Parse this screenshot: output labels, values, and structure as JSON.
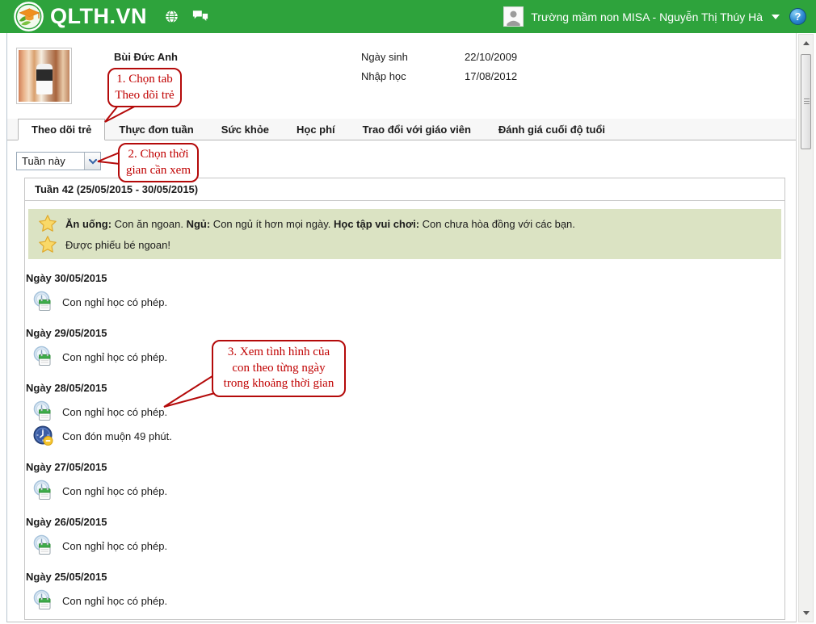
{
  "header": {
    "brand": "QLTH.VN",
    "account": "Trường mầm non MISA - Nguyễn Thị Thúy Hà",
    "help_glyph": "?"
  },
  "student": {
    "name": "Bùi Đức Anh",
    "birth_label": "Ngày sinh",
    "birth_value": "22/10/2009",
    "enroll_label": "Nhập học",
    "enroll_value": "17/08/2012"
  },
  "tabs": [
    {
      "label": "Theo dõi trẻ",
      "active": true
    },
    {
      "label": "Thực đơn tuần",
      "active": false
    },
    {
      "label": "Sức khỏe",
      "active": false
    },
    {
      "label": "Học phí",
      "active": false
    },
    {
      "label": "Trao đổi với giáo viên",
      "active": false
    },
    {
      "label": "Đánh giá cuối độ tuổi",
      "active": false
    }
  ],
  "filter": {
    "selected": "Tuần này"
  },
  "week": {
    "title": "Tuần 42 (25/05/2015 - 30/05/2015)"
  },
  "summary": {
    "line1": [
      {
        "label": "Ăn uống:",
        "text": "Con ăn ngoan."
      },
      {
        "label": "Ngủ:",
        "text": "Con ngủ ít hơn mọi ngày."
      },
      {
        "label": "Học tập vui chơi:",
        "text": "Con chưa hòa đồng với các bạn."
      }
    ],
    "line2": "Được phiếu bé ngoan!"
  },
  "days": [
    {
      "date": "Ngày 30/05/2015",
      "events": [
        {
          "icon": "absence-permitted",
          "text": "Con nghỉ học có phép."
        }
      ]
    },
    {
      "date": "Ngày 29/05/2015",
      "events": [
        {
          "icon": "absence-permitted",
          "text": "Con nghỉ học có phép."
        }
      ]
    },
    {
      "date": "Ngày 28/05/2015",
      "events": [
        {
          "icon": "absence-permitted",
          "text": "Con nghỉ học có phép."
        },
        {
          "icon": "late-pickup",
          "text": "Con đón muộn 49 phút."
        }
      ]
    },
    {
      "date": "Ngày 27/05/2015",
      "events": [
        {
          "icon": "absence-permitted",
          "text": "Con nghỉ học có phép."
        }
      ]
    },
    {
      "date": "Ngày 26/05/2015",
      "events": [
        {
          "icon": "absence-permitted",
          "text": "Con nghỉ học có phép."
        }
      ]
    },
    {
      "date": "Ngày 25/05/2015",
      "events": [
        {
          "icon": "absence-permitted",
          "text": "Con nghỉ học có phép."
        }
      ]
    }
  ],
  "callouts": {
    "c1": "1. Chọn tab\nTheo dõi trẻ",
    "c2": "2. Chọn thời\ngian cần xem",
    "c3": "3. Xem tình hình của\ncon theo từng ngày\ntrong khoảng thời gian"
  },
  "icons": {
    "topbar": [
      "app-logo-icon",
      "globe-icon",
      "chat-icon",
      "avatar",
      "caret-down-icon",
      "help-icon"
    ],
    "filter": "chevron-down-icon",
    "summary": "star-icon",
    "events": [
      "absence-permitted-icon",
      "late-pickup-icon"
    ]
  },
  "colors": {
    "header_green": "#2ea33c",
    "callout_red": "#c00000",
    "note_bg": "#dbe3c3",
    "star_yellow": "#f9d968",
    "accent_blue": "#3a66a8"
  }
}
